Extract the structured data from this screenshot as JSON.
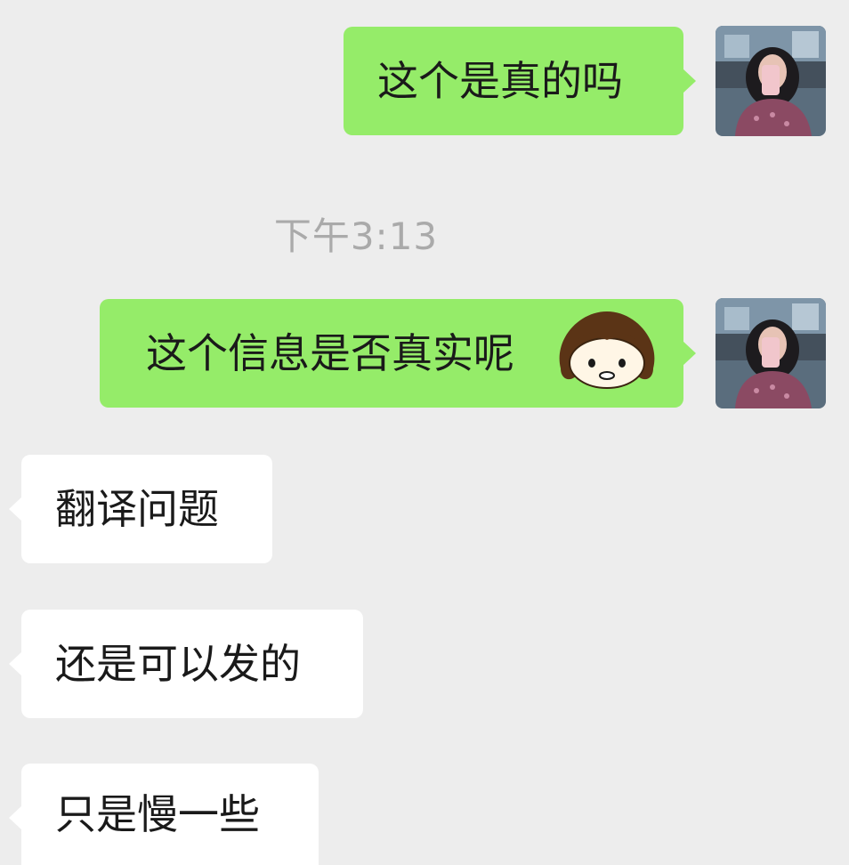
{
  "chat": {
    "timestamp": "下午3:13",
    "messages": [
      {
        "side": "sent",
        "text": "这个是真的吗"
      },
      {
        "side": "sent",
        "text": "这个信息是否真实呢",
        "emoji": "girl-face-emoji"
      },
      {
        "side": "received",
        "text": "翻译问题"
      },
      {
        "side": "received",
        "text": "还是可以发的"
      },
      {
        "side": "received",
        "text": "只是慢一些"
      }
    ]
  },
  "colors": {
    "background": "#ededed",
    "sent_bubble": "#95ec69",
    "received_bubble": "#ffffff",
    "timestamp_text": "#aaaaaa",
    "message_text": "#1a1a1a"
  },
  "icons": {
    "avatar": "user-avatar-photo",
    "emoji": "girl-face-emoji"
  }
}
